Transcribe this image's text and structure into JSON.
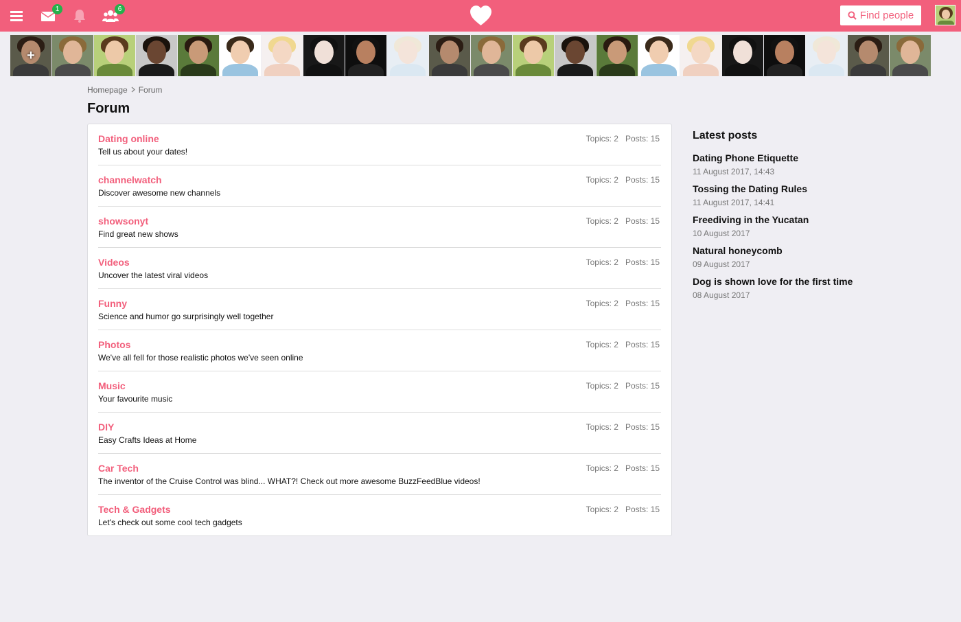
{
  "header": {
    "menu_icon": "hamburger-icon",
    "messages_badge": "1",
    "friends_badge": "6",
    "find_people_label": "Find people",
    "colors": {
      "brand": "#f25f7c",
      "badge": "#25b14b"
    }
  },
  "strip": {
    "photos": [
      {
        "skin": "#b58a6e",
        "hair": "#2b1d14",
        "body": "#3a3a3a",
        "bg": "#5a5a4a",
        "add": true
      },
      {
        "skin": "#e0b698",
        "hair": "#8a6a3a",
        "body": "#4a4a4a",
        "bg": "#7b8a6a"
      },
      {
        "skin": "#edc9a8",
        "hair": "#5a3a1e",
        "body": "#6a8a3a",
        "bg": "#b8d07a"
      },
      {
        "skin": "#6a4632",
        "hair": "#1a120c",
        "body": "#1a1a1a",
        "bg": "#c8c8c8"
      },
      {
        "skin": "#c99a78",
        "hair": "#2a1a10",
        "body": "#2a3a1a",
        "bg": "#5a7a3a"
      },
      {
        "skin": "#f0cdb0",
        "hair": "#3a2a1a",
        "body": "#9ac4e0",
        "bg": "#ffffff"
      },
      {
        "skin": "#f4d8c4",
        "hair": "#f0d890",
        "body": "#f0d0c0",
        "bg": "#f5f0f0"
      },
      {
        "skin": "#f0e0d8",
        "hair": "#111111",
        "body": "#111111",
        "bg": "#181818"
      },
      {
        "skin": "#b88060",
        "hair": "#111111",
        "body": "#222222",
        "bg": "#0e0e0e"
      },
      {
        "skin": "#f4e4da",
        "hair": "#f0e8d8",
        "body": "#dbe8f2",
        "bg": "#e8eef4"
      }
    ]
  },
  "breadcrumb": {
    "home": "Homepage",
    "current": "Forum"
  },
  "page": {
    "title": "Forum"
  },
  "forums": [
    {
      "name": "Dating online",
      "desc": "Tell us about your dates!",
      "topics": "Topics: 2",
      "posts": "Posts: 15"
    },
    {
      "name": "channelwatch",
      "desc": "Discover awesome new channels",
      "topics": "Topics: 2",
      "posts": "Posts: 15"
    },
    {
      "name": "showsonyt",
      "desc": "Find great new shows",
      "topics": "Topics: 2",
      "posts": "Posts: 15"
    },
    {
      "name": "Videos",
      "desc": "Uncover the latest viral videos",
      "topics": "Topics: 2",
      "posts": "Posts: 15"
    },
    {
      "name": "Funny",
      "desc": "Science and humor go surprisingly well together",
      "topics": "Topics: 2",
      "posts": "Posts: 15"
    },
    {
      "name": "Photos",
      "desc": "We've all fell for those realistic photos we've seen online",
      "topics": "Topics: 2",
      "posts": "Posts: 15"
    },
    {
      "name": "Music",
      "desc": "Your favourite music",
      "topics": "Topics: 2",
      "posts": "Posts: 15"
    },
    {
      "name": "DIY",
      "desc": "Easy Crafts Ideas at Home",
      "topics": "Topics: 2",
      "posts": "Posts: 15"
    },
    {
      "name": "Car Tech",
      "desc": "The inventor of the Cruise Control was blind... WHAT?! Check out more awesome BuzzFeedBlue videos!",
      "topics": "Topics: 2",
      "posts": "Posts: 15"
    },
    {
      "name": "Tech & Gadgets",
      "desc": "Let's check out some cool tech gadgets",
      "topics": "Topics: 2",
      "posts": "Posts: 15"
    }
  ],
  "sidebar": {
    "title": "Latest posts",
    "posts": [
      {
        "title": "Dating Phone Etiquette",
        "date": "11 August 2017, 14:43"
      },
      {
        "title": "Tossing the Dating Rules",
        "date": "11 August 2017, 14:41"
      },
      {
        "title": "Freediving in the Yucatan",
        "date": "10 August 2017"
      },
      {
        "title": "Natural honeycomb",
        "date": "09 August 2017"
      },
      {
        "title": "Dog is shown love for the first time",
        "date": "08 August 2017"
      }
    ]
  }
}
